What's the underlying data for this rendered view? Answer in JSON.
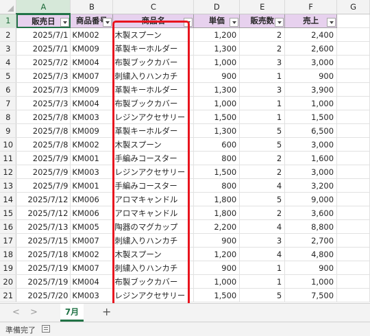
{
  "columns": [
    "A",
    "B",
    "C",
    "D",
    "E",
    "F",
    "G"
  ],
  "header_row_number": "1",
  "headers": [
    "販売日",
    "商品番号",
    "商品名",
    "単価",
    "販売数",
    "売上"
  ],
  "rows": [
    {
      "n": "2",
      "date": "2025/7/1",
      "code": "KM002",
      "name": "木製スプーン",
      "price": "1,200",
      "qty": "2",
      "sales": "2,400"
    },
    {
      "n": "3",
      "date": "2025/7/1",
      "code": "KM009",
      "name": "革製キーホルダー",
      "price": "1,300",
      "qty": "2",
      "sales": "2,600"
    },
    {
      "n": "4",
      "date": "2025/7/2",
      "code": "KM004",
      "name": "布製ブックカバー",
      "price": "1,000",
      "qty": "3",
      "sales": "3,000"
    },
    {
      "n": "5",
      "date": "2025/7/3",
      "code": "KM007",
      "name": "刺繍入りハンカチ",
      "price": "900",
      "qty": "1",
      "sales": "900"
    },
    {
      "n": "6",
      "date": "2025/7/3",
      "code": "KM009",
      "name": "革製キーホルダー",
      "price": "1,300",
      "qty": "3",
      "sales": "3,900"
    },
    {
      "n": "7",
      "date": "2025/7/3",
      "code": "KM004",
      "name": "布製ブックカバー",
      "price": "1,000",
      "qty": "1",
      "sales": "1,000"
    },
    {
      "n": "8",
      "date": "2025/7/8",
      "code": "KM003",
      "name": "レジンアクセサリー",
      "price": "1,500",
      "qty": "1",
      "sales": "1,500"
    },
    {
      "n": "9",
      "date": "2025/7/8",
      "code": "KM009",
      "name": "革製キーホルダー",
      "price": "1,300",
      "qty": "5",
      "sales": "6,500"
    },
    {
      "n": "10",
      "date": "2025/7/8",
      "code": "KM002",
      "name": "木製スプーン",
      "price": "600",
      "qty": "5",
      "sales": "3,000"
    },
    {
      "n": "11",
      "date": "2025/7/9",
      "code": "KM001",
      "name": "手編みコースター",
      "price": "800",
      "qty": "2",
      "sales": "1,600"
    },
    {
      "n": "12",
      "date": "2025/7/9",
      "code": "KM003",
      "name": "レジンアクセサリー",
      "price": "1,500",
      "qty": "2",
      "sales": "3,000"
    },
    {
      "n": "13",
      "date": "2025/7/9",
      "code": "KM001",
      "name": "手編みコースター",
      "price": "800",
      "qty": "4",
      "sales": "3,200"
    },
    {
      "n": "14",
      "date": "2025/7/12",
      "code": "KM006",
      "name": "アロマキャンドル",
      "price": "1,800",
      "qty": "5",
      "sales": "9,000"
    },
    {
      "n": "15",
      "date": "2025/7/12",
      "code": "KM006",
      "name": "アロマキャンドル",
      "price": "1,800",
      "qty": "2",
      "sales": "3,600"
    },
    {
      "n": "16",
      "date": "2025/7/13",
      "code": "KM005",
      "name": "陶器のマグカップ",
      "price": "2,200",
      "qty": "4",
      "sales": "8,800"
    },
    {
      "n": "17",
      "date": "2025/7/15",
      "code": "KM007",
      "name": "刺繍入りハンカチ",
      "price": "900",
      "qty": "3",
      "sales": "2,700"
    },
    {
      "n": "18",
      "date": "2025/7/18",
      "code": "KM002",
      "name": "木製スプーン",
      "price": "1,200",
      "qty": "4",
      "sales": "4,800"
    },
    {
      "n": "19",
      "date": "2025/7/19",
      "code": "KM007",
      "name": "刺繍入りハンカチ",
      "price": "900",
      "qty": "1",
      "sales": "900"
    },
    {
      "n": "20",
      "date": "2025/7/19",
      "code": "KM004",
      "name": "布製ブックカバー",
      "price": "1,000",
      "qty": "1",
      "sales": "1,000"
    },
    {
      "n": "21",
      "date": "2025/7/20",
      "code": "KM003",
      "name": "レジンアクセサリー",
      "price": "1,500",
      "qty": "5",
      "sales": "7,500"
    }
  ],
  "sheet_tabs": [
    "7月"
  ],
  "nav": {
    "prev": "<",
    "next": ">",
    "add": "+"
  },
  "status": {
    "text": "準備完了"
  },
  "colors": {
    "header_fill": "#e7d1ee",
    "highlight": "#e8141e",
    "accent": "#217346"
  }
}
